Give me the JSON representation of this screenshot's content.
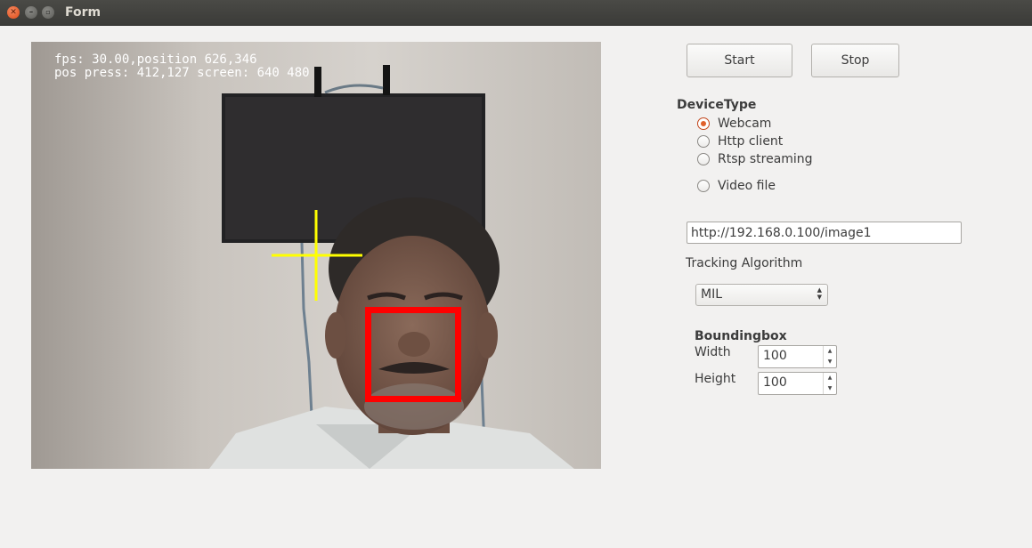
{
  "window": {
    "title": "Form"
  },
  "video": {
    "overlay_line1": "fps: 30.00,position 626,346",
    "overlay_line2": "pos press: 412,127 screen: 640 480",
    "tracking_box_color": "#ff0000",
    "crosshair_color": "#ffff00"
  },
  "controls": {
    "start_label": "Start",
    "stop_label": "Stop",
    "device_type_heading": "DeviceType",
    "device_options": [
      "Webcam",
      "Http client",
      "Rtsp streaming",
      "Video file"
    ],
    "selected_device": "Webcam",
    "url_value": "http://192.168.0.100/image1",
    "tracking_label": "Tracking Algorithm",
    "tracking_value": "MIL",
    "bbox_heading": "Boundingbox",
    "width_label": "Width",
    "width_value": "100",
    "height_label": "Height",
    "height_value": "100"
  },
  "colors": {
    "accent": "#e0612c"
  }
}
